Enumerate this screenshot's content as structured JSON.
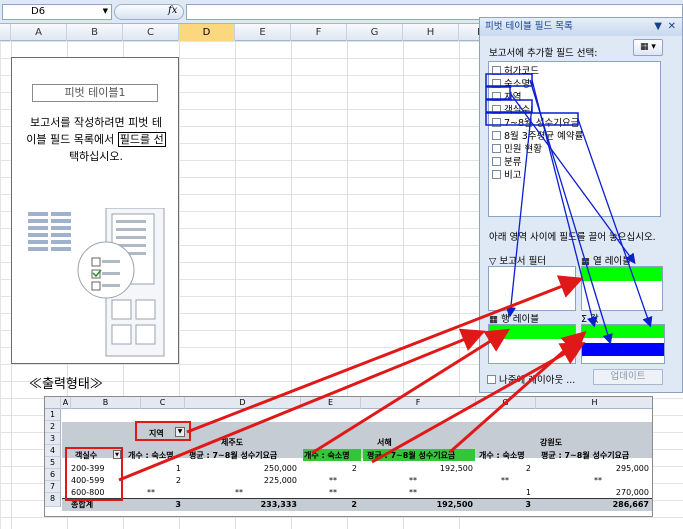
{
  "formula_bar": {
    "cell_ref": "D6",
    "fx_label": "fx",
    "value": ""
  },
  "columns": [
    "A",
    "B",
    "C",
    "D",
    "E",
    "F",
    "G",
    "H",
    "I"
  ],
  "selected_column": "D",
  "pivot_placeholder": {
    "name": "피벗 테이블1",
    "msg_line1": "보고서를 작성하려면 피벗 테",
    "msg_line2a": "이블 필드 목록에서 ",
    "msg_line2b": "필드를 선",
    "msg_line3": "택하십시오."
  },
  "field_pane": {
    "title": "피벗 테이블 필드 목록",
    "subtitle": "보고서에 추가할 필드 선택:",
    "fields": [
      "허가코드",
      "숙소명",
      "지역",
      "객실수",
      "7~8월 성수기요금",
      "8월 3주평균 예약률",
      "민원 현황",
      "분류",
      "비고"
    ],
    "drag_hint": "아래 영역 사이에 필드를 끌어 놓으십시오.",
    "zone_report_filter": "보고서 필터",
    "zone_column_labels": "열 레이블",
    "zone_row_labels": "행 레이블",
    "zone_values": "값",
    "defer_label": "나중에 레이아웃 ...",
    "update_button": "업데이트"
  },
  "output_caption": "≪출력형태≫",
  "output_sheet": {
    "col_headers": [
      "A",
      "B",
      "C",
      "D",
      "E",
      "F",
      "G",
      "H"
    ],
    "row_numbers": [
      "1",
      "2",
      "3",
      "4",
      "5",
      "6",
      "7",
      "8"
    ],
    "filter_label": "지역",
    "region_jeju": "제주도",
    "region_seohae": "서해",
    "region_gangwon": "강원도",
    "hdr_rooms": "객실수",
    "hdr_count": "개수 : 숙소명",
    "hdr_avg": "평균 : 7~8월 성수기요금",
    "rows": [
      {
        "label": "200-399",
        "c1": "1",
        "a1": "250,000",
        "c2": "2",
        "a2": "192,500",
        "c3": "2",
        "a3": "295,000"
      },
      {
        "label": "400-599",
        "c1": "2",
        "a1": "225,000",
        "c2": "**",
        "a2": "**",
        "c3": "**",
        "a3": "**"
      },
      {
        "label": "600-800",
        "c1": "**",
        "a1": "**",
        "c2": "**",
        "a2": "**",
        "c3": "1",
        "a3": "270,000"
      }
    ],
    "total": {
      "label": "총합계",
      "c1": "3",
      "a1": "233,333",
      "c2": "2",
      "a2": "192,500",
      "c3": "3",
      "a3": "286,667"
    }
  },
  "colors": {
    "accent_green": "#00ff00",
    "accent_blue": "#0000ff",
    "arrow_red": "#e01818",
    "arrow_blue": "#0a1fd0"
  }
}
